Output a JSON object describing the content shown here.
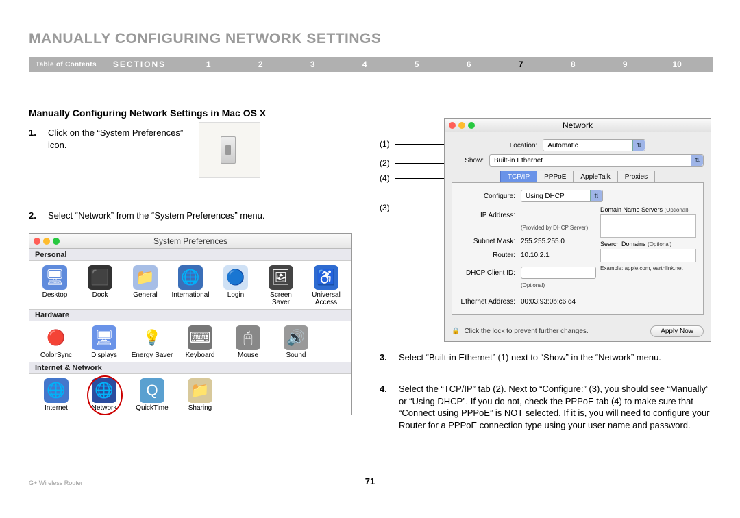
{
  "page": {
    "title": "MANUALLY CONFIGURING NETWORK SETTINGS",
    "number": "71",
    "footer_left": "G+ Wireless Router"
  },
  "nav": {
    "toc": "Table of Contents",
    "sections_label": "SECTIONS",
    "numbers": [
      "1",
      "2",
      "3",
      "4",
      "5",
      "6",
      "7",
      "8",
      "9",
      "10"
    ],
    "active": "7"
  },
  "subheader": "Manually Configuring Network Settings in Mac OS X",
  "steps": {
    "s1": {
      "num": "1.",
      "text": "Click on the “System Preferences” icon."
    },
    "s2": {
      "num": "2.",
      "text": "Select “Network” from the “System Preferences” menu."
    },
    "s3": {
      "num": "3.",
      "text": "Select “Built-in Ethernet” (1) next to “Show” in the “Network” menu."
    },
    "s4": {
      "num": "4.",
      "text": "Select the “TCP/IP” tab (2). Next to “Configure:” (3), you should see “Manually” or “Using DHCP”. If you do not, check the PPPoE tab (4) to make sure that “Connect using PPPoE” is NOT selected. If it is, you will need to configure your Router for a PPPoE connection type using your user name and password."
    }
  },
  "callouts": {
    "c1": "(1)",
    "c2": "(2)",
    "c3": "(3)",
    "c4": "(4)"
  },
  "sysprefs": {
    "title": "System Preferences",
    "cats": {
      "personal": {
        "label": "Personal",
        "items": [
          {
            "name": "Desktop",
            "icon": "🖥",
            "bg": "#5f8bdc"
          },
          {
            "name": "Dock",
            "icon": "⬛",
            "bg": "#333"
          },
          {
            "name": "General",
            "icon": "📁",
            "bg": "#a7bee6"
          },
          {
            "name": "International",
            "icon": "🌐",
            "bg": "#3b6fb8"
          },
          {
            "name": "Login",
            "icon": "🔵",
            "bg": "#cfe1f5"
          },
          {
            "name": "Screen Saver",
            "icon": "🖼",
            "bg": "#444"
          },
          {
            "name": "Universal Access",
            "icon": "♿",
            "bg": "#2e6bd0"
          }
        ]
      },
      "hardware": {
        "label": "Hardware",
        "items": [
          {
            "name": "ColorSync",
            "icon": "🔴",
            "bg": "#fff"
          },
          {
            "name": "Displays",
            "icon": "🖥",
            "bg": "#6a93e8"
          },
          {
            "name": "Energy Saver",
            "icon": "💡",
            "bg": "#fff"
          },
          {
            "name": "Keyboard",
            "icon": "⌨",
            "bg": "#777"
          },
          {
            "name": "Mouse",
            "icon": "🖱",
            "bg": "#888"
          },
          {
            "name": "Sound",
            "icon": "🔊",
            "bg": "#999"
          }
        ]
      },
      "internet": {
        "label": "Internet & Network",
        "items": [
          {
            "name": "Internet",
            "icon": "🌐",
            "bg": "#4477cc"
          },
          {
            "name": "Network",
            "icon": "🌐",
            "bg": "#2b4d9f"
          },
          {
            "name": "QuickTime",
            "icon": "Q",
            "bg": "#5aa0d0"
          },
          {
            "name": "Sharing",
            "icon": "📁",
            "bg": "#d8c99b"
          }
        ]
      }
    }
  },
  "network": {
    "title": "Network",
    "location_label": "Location:",
    "location_value": "Automatic",
    "show_label": "Show:",
    "show_value": "Built-in Ethernet",
    "tabs": [
      "TCP/IP",
      "PPPoE",
      "AppleTalk",
      "Proxies"
    ],
    "active_tab": "TCP/IP",
    "configure_label": "Configure:",
    "configure_value": "Using DHCP",
    "ip_label": "IP Address:",
    "ip_note": "(Provided by DHCP Server)",
    "subnet_label": "Subnet Mask:",
    "subnet_value": "255.255.255.0",
    "router_label": "Router:",
    "router_value": "10.10.2.1",
    "dhcp_label": "DHCP Client ID:",
    "dhcp_note": "(Optional)",
    "eth_label": "Ethernet Address:",
    "eth_value": "00:03:93:0b:c6:d4",
    "dns_title": "Domain Name Servers",
    "dns_opt": "(Optional)",
    "search_title": "Search Domains",
    "search_opt": "(Optional)",
    "example": "Example: apple.com, earthlink.net",
    "lock_text": "Click the lock to prevent further changes.",
    "apply": "Apply Now"
  }
}
